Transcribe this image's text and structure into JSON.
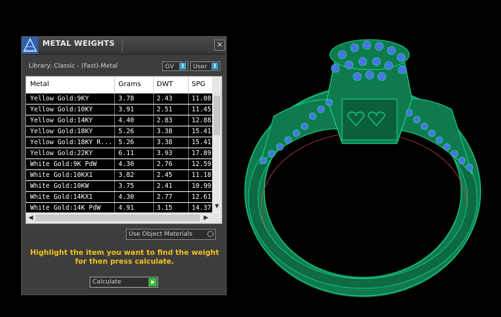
{
  "dialog": {
    "title": "METAL WEIGHTS",
    "close_glyph": "✕",
    "library_label": "Library: Classic - (Fast)-Metal",
    "chips": [
      {
        "label": "GV",
        "toggle": "I"
      },
      {
        "label": "User",
        "toggle": "I"
      }
    ],
    "columns": [
      "Metal",
      "Grams",
      "DWT",
      "SPG"
    ],
    "rows": [
      [
        "Yellow Gold:9KY",
        "3.78",
        "2.43",
        "11.08"
      ],
      [
        "Yellow Gold:10KY",
        "3.91",
        "2.51",
        "11.45"
      ],
      [
        "Yellow Gold:14KY",
        "4.40",
        "2.83",
        "12.88"
      ],
      [
        "Yellow Gold:18KY",
        "5.26",
        "3.38",
        "15.41"
      ],
      [
        "Yellow Gold:18KY R...",
        "5.26",
        "3.38",
        "15.41"
      ],
      [
        "Yellow Gold:22KY",
        "6.11",
        "3.93",
        "17.89"
      ],
      [
        "White Gold:9K PdW",
        "4.30",
        "2.76",
        "12.59"
      ],
      [
        "White Gold:10KX1",
        "3.82",
        "2.45",
        "11.18"
      ],
      [
        "White Gold:10KW",
        "3.75",
        "2.41",
        "10.99"
      ],
      [
        "White Gold:14KX1",
        "4.30",
        "2.77",
        "12.61"
      ],
      [
        "White Gold:14K PdW",
        "4.91",
        "3.15",
        "14.37"
      ]
    ],
    "use_object_materials": "Use Object Materials",
    "hint": "Highlight the item you want to find the weight for then press calculate.",
    "calculate_label": "Calculate"
  },
  "viewport": {
    "subject": "ring-model",
    "colors": {
      "metal": "#0f7a4d",
      "wire": "#18d98a",
      "stones": "#4a74e6",
      "shank_accent": "#c84040"
    }
  }
}
